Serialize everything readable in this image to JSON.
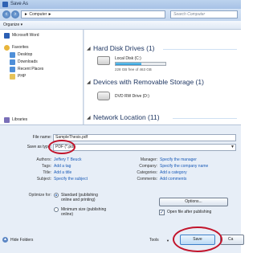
{
  "window": {
    "title": "Save As"
  },
  "address": {
    "path": "► Computer ►",
    "search_placeholder": "Search Computer"
  },
  "toolbar": {
    "organize": "Organize ▾"
  },
  "nav": {
    "items": [
      {
        "label": "Microsoft Word",
        "icon": "word-icon",
        "color": "#2b5fb4"
      },
      {
        "label": "Favorites",
        "icon": "star-icon",
        "color": "#e8b53b"
      },
      {
        "label": "Desktop",
        "icon": "folder-icon",
        "color": "#4f8fd8"
      },
      {
        "label": "Downloads",
        "icon": "folder-icon",
        "color": "#4f8fd8"
      },
      {
        "label": "Recent Places",
        "icon": "folder-icon",
        "color": "#4f8fd8"
      },
      {
        "label": "PHP",
        "icon": "folder-icon",
        "color": "#e6c35a"
      },
      {
        "label": "Libraries",
        "icon": "library-icon",
        "color": "#7a6fb8"
      }
    ]
  },
  "main": {
    "hdd_group": "Hard Disk Drives (1)",
    "local_disk_name": "Local Disk (C:)",
    "local_disk_free": "228 GB free of 463 GB",
    "local_disk_used_fraction": 0.51,
    "removable_group": "Devices with Removable Storage (1)",
    "dvd_name": "DVD RW Drive (D:)",
    "network_group": "Network Location (11)"
  },
  "form": {
    "filename_label": "File name:",
    "filename_value": "SampleThesis.pdf",
    "saveas_label": "Save as type:",
    "saveas_value": "PDF (*.pdf)",
    "authors_label": "Authors:",
    "authors_value": "Jeffery T Beuck",
    "tags_label": "Tags:",
    "tags_value": "Add a tag",
    "title_label": "Title:",
    "title_value": "Add a title",
    "subject_label": "Subject:",
    "subject_value": "Specify the subject",
    "manager_label": "Manager:",
    "manager_value": "Specify the manager",
    "company_label": "Company:",
    "company_value": "Specify the company name",
    "categories_label": "Categories:",
    "categories_value": "Add a category",
    "comments_label": "Comments:",
    "comments_value": "Add comments",
    "optimize_label": "Optimize for:",
    "opt_standard": "Standard (publishing online and printing)",
    "opt_minimum": "Minimum size (publishing online)",
    "options_button": "Options...",
    "open_after": "Open file after publishing"
  },
  "footer": {
    "hide_folders": "Hide Folders",
    "tools": "Tools",
    "save": "Save",
    "cancel": "Ca"
  },
  "colors": {
    "highlight": "#c2142b",
    "link": "#1a5bb7"
  }
}
